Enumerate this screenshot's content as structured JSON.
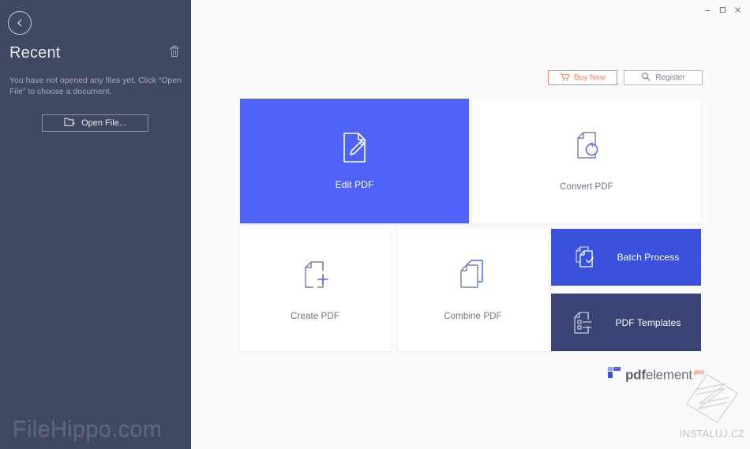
{
  "window": {
    "controls": [
      {
        "name": "minimize",
        "glyph": "–"
      },
      {
        "name": "maximize",
        "glyph": "□"
      },
      {
        "name": "close",
        "glyph": "✕"
      }
    ]
  },
  "sidebar": {
    "back_icon": "chevron-left-icon",
    "title": "Recent",
    "delete_icon": "trash-icon",
    "description": "You have not opened any files yet. Click “Open File” to choose a document.",
    "open_file": {
      "label": "Open File...",
      "icon": "folder-add-icon"
    },
    "watermark": "FileHippo.com"
  },
  "toolbar": {
    "buy": {
      "label": "Buy Now",
      "icon": "cart-icon",
      "color": "#f08562"
    },
    "register": {
      "label": "Register",
      "icon": "search-icon",
      "color": "#7c808e"
    }
  },
  "tiles": [
    {
      "id": "edit",
      "label": "Edit PDF",
      "icon": "document-edit-icon",
      "bg": "#4f63fb",
      "variant": "primary"
    },
    {
      "id": "convert",
      "label": "Convert PDF",
      "icon": "document-refresh-icon",
      "bg": "#ffffff",
      "variant": "plain"
    },
    {
      "id": "create",
      "label": "Create PDF",
      "icon": "document-plus-icon",
      "bg": "#ffffff",
      "variant": "plain"
    },
    {
      "id": "combine",
      "label": "Combine PDF",
      "icon": "documents-stack-icon",
      "bg": "#ffffff",
      "variant": "plain"
    },
    {
      "id": "batch",
      "label": "Batch Process",
      "icon": "documents-check-icon",
      "bg": "#3a51db",
      "variant": "accent"
    },
    {
      "id": "templates",
      "label": "PDF Templates",
      "icon": "document-list-icon",
      "bg": "#3a4474",
      "variant": "dark"
    }
  ],
  "brand": {
    "bold": "pdf",
    "thin": "element",
    "super": "pro"
  },
  "watermark": {
    "instaluj": "INSTALUJ.CZ"
  },
  "colors": {
    "sidebar_bg": "#414861",
    "main_bg": "#fafafb",
    "accent_blue": "#4f63fb",
    "accent_orange": "#f08562",
    "dark_tile": "#3a4474"
  }
}
